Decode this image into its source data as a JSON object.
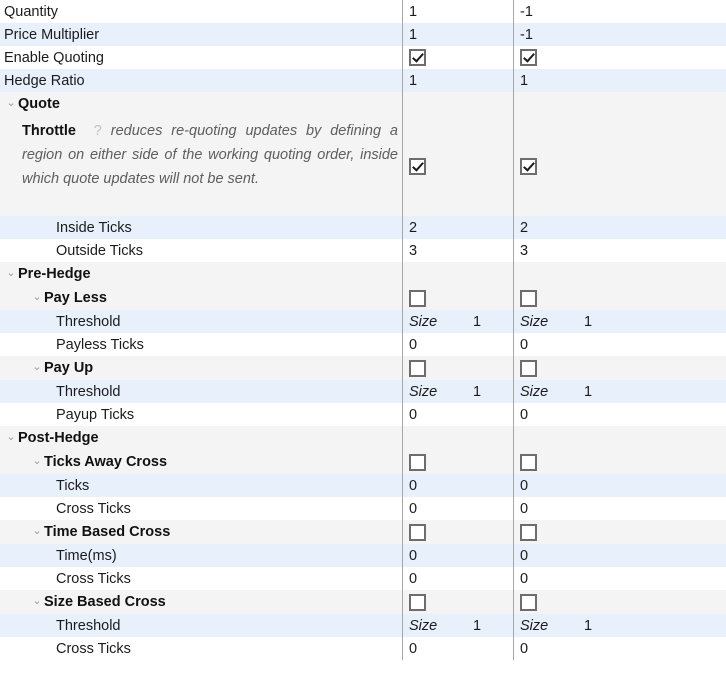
{
  "columns": {
    "label_header": "",
    "col1_header": "",
    "col2_header": ""
  },
  "icons": {
    "chevron_expanded": "⌄",
    "help": "?"
  },
  "rows": [
    {
      "id": "quantity",
      "label": "Quantity",
      "indent": 0,
      "type": "value",
      "stripe": "white",
      "col1": "1",
      "col2": "-1"
    },
    {
      "id": "price-multiplier",
      "label": "Price Multiplier",
      "indent": 0,
      "type": "value",
      "stripe": "alt",
      "col1": "1",
      "col2": "-1"
    },
    {
      "id": "enable-quoting",
      "label": "Enable Quoting",
      "indent": 0,
      "type": "checkbox",
      "stripe": "white",
      "col1_checked": true,
      "col2_checked": true
    },
    {
      "id": "hedge-ratio",
      "label": "Hedge Ratio",
      "indent": 0,
      "type": "value",
      "stripe": "alt",
      "col1": "1",
      "col2": "1"
    },
    {
      "id": "quote",
      "label": "Quote",
      "indent": 0,
      "type": "group",
      "stripe": "group",
      "chevron": "gray"
    },
    {
      "id": "throttle",
      "label": "Throttle",
      "indent": 1,
      "type": "description",
      "stripe": "group",
      "chevron": "dark",
      "description": "reduces re-quoting updates by defining a region on either side of the working quoting order, inside which quote updates will not be sent.",
      "col1_checked": true,
      "col2_checked": true
    },
    {
      "id": "inside-ticks",
      "label": "Inside Ticks",
      "indent": 2,
      "type": "value",
      "stripe": "alt",
      "col1": "2",
      "col2": "2"
    },
    {
      "id": "outside-ticks",
      "label": "Outside Ticks",
      "indent": 2,
      "type": "value",
      "stripe": "white",
      "col1": "3",
      "col2": "3"
    },
    {
      "id": "pre-hedge",
      "label": "Pre-Hedge",
      "indent": 0,
      "type": "group",
      "stripe": "group",
      "chevron": "gray"
    },
    {
      "id": "pay-less",
      "label": "Pay Less",
      "indent": 1,
      "type": "group-checkbox",
      "stripe": "group",
      "chevron": "gray",
      "col1_checked": false,
      "col2_checked": false
    },
    {
      "id": "pay-less-threshold",
      "label": "Threshold",
      "indent": 2,
      "type": "size",
      "stripe": "alt",
      "col1_unit": "Size",
      "col1": "1",
      "col2_unit": "Size",
      "col2": "1"
    },
    {
      "id": "payless-ticks",
      "label": "Payless Ticks",
      "indent": 2,
      "type": "value",
      "stripe": "white",
      "col1": "0",
      "col2": "0"
    },
    {
      "id": "pay-up",
      "label": "Pay Up",
      "indent": 1,
      "type": "group-checkbox",
      "stripe": "group",
      "chevron": "gray",
      "col1_checked": false,
      "col2_checked": false
    },
    {
      "id": "pay-up-threshold",
      "label": "Threshold",
      "indent": 2,
      "type": "size",
      "stripe": "alt",
      "col1_unit": "Size",
      "col1": "1",
      "col2_unit": "Size",
      "col2": "1"
    },
    {
      "id": "payup-ticks",
      "label": "Payup Ticks",
      "indent": 2,
      "type": "value",
      "stripe": "white",
      "col1": "0",
      "col2": "0"
    },
    {
      "id": "post-hedge",
      "label": "Post-Hedge",
      "indent": 0,
      "type": "group",
      "stripe": "group",
      "chevron": "gray"
    },
    {
      "id": "ticks-away-cross",
      "label": "Ticks Away Cross",
      "indent": 1,
      "type": "group-checkbox",
      "stripe": "group",
      "chevron": "gray",
      "col1_checked": false,
      "col2_checked": false
    },
    {
      "id": "ticks",
      "label": "Ticks",
      "indent": 2,
      "type": "value",
      "stripe": "alt",
      "col1": "0",
      "col2": "0"
    },
    {
      "id": "ticks-away-cross-ticks",
      "label": "Cross Ticks",
      "indent": 2,
      "type": "value",
      "stripe": "white",
      "col1": "0",
      "col2": "0"
    },
    {
      "id": "time-based-cross",
      "label": "Time Based Cross",
      "indent": 1,
      "type": "group-checkbox",
      "stripe": "group",
      "chevron": "gray",
      "col1_checked": false,
      "col2_checked": false
    },
    {
      "id": "time-ms",
      "label": "Time(ms)",
      "indent": 2,
      "type": "value",
      "stripe": "alt",
      "col1": "0",
      "col2": "0"
    },
    {
      "id": "time-based-cross-ticks",
      "label": "Cross Ticks",
      "indent": 2,
      "type": "value",
      "stripe": "white",
      "col1": "0",
      "col2": "0"
    },
    {
      "id": "size-based-cross",
      "label": "Size Based Cross",
      "indent": 1,
      "type": "group-checkbox",
      "stripe": "group",
      "chevron": "gray",
      "col1_checked": false,
      "col2_checked": false
    },
    {
      "id": "size-based-threshold",
      "label": "Threshold",
      "indent": 2,
      "type": "size",
      "stripe": "alt",
      "col1_unit": "Size",
      "col1": "1",
      "col2_unit": "Size",
      "col2": "1"
    },
    {
      "id": "size-based-cross-ticks",
      "label": "Cross Ticks",
      "indent": 2,
      "type": "value",
      "stripe": "white",
      "col1": "0",
      "col2": "0"
    }
  ]
}
